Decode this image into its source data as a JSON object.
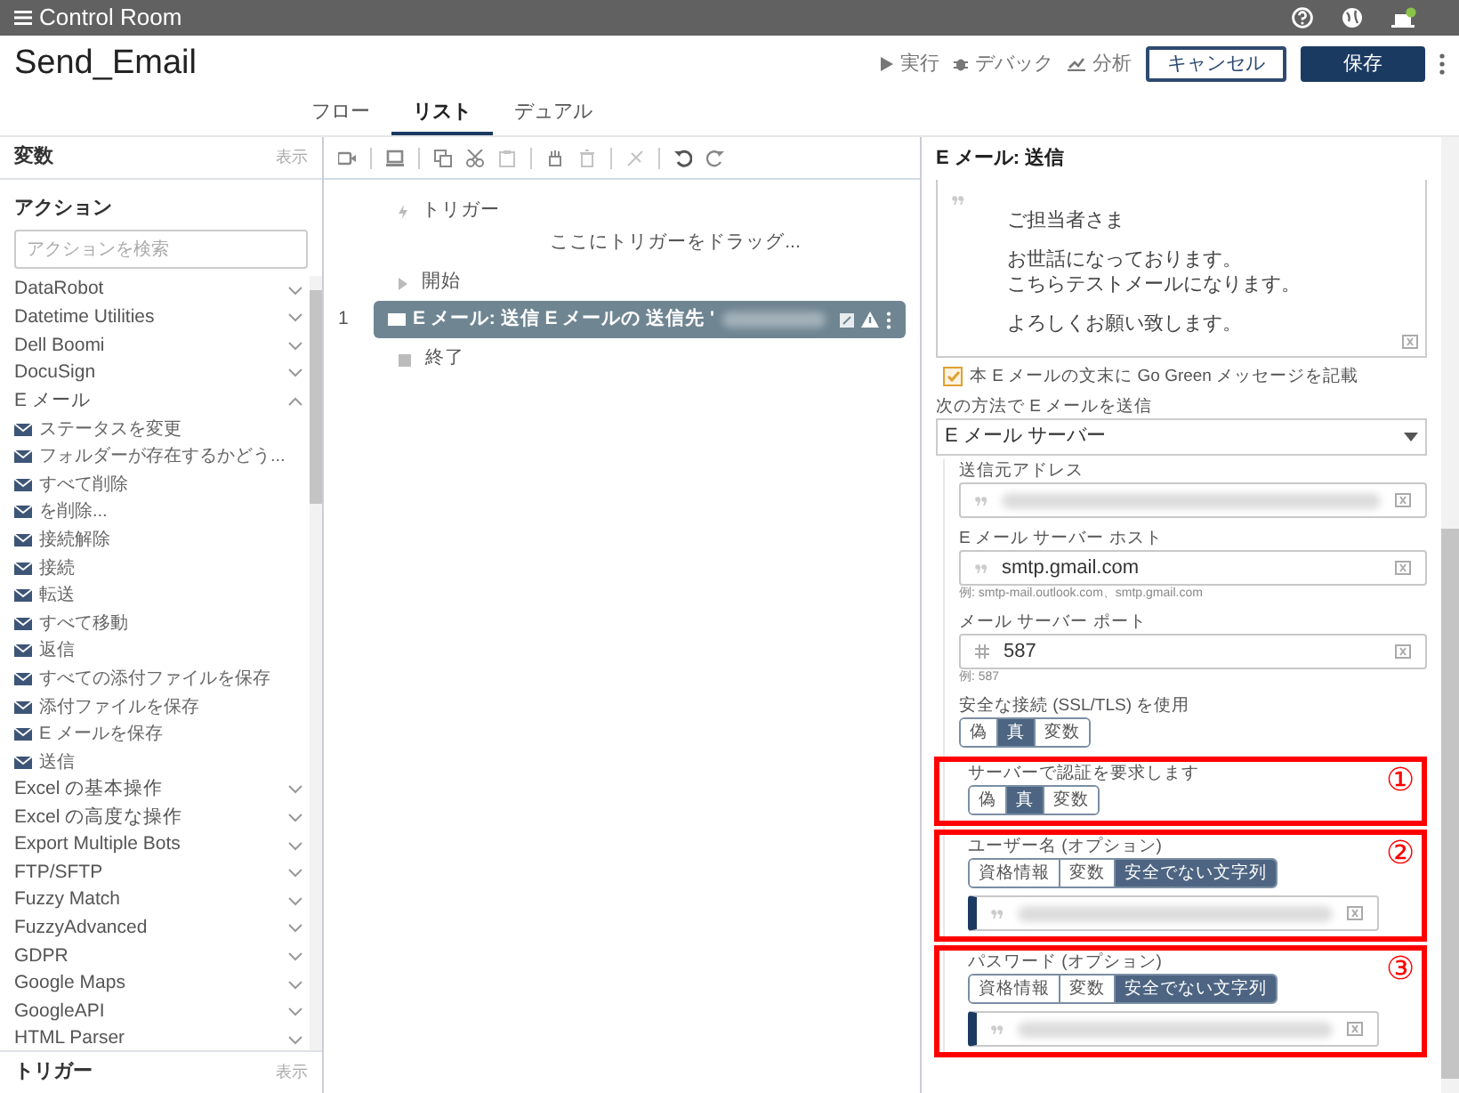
{
  "header": {
    "app_title": "Control Room"
  },
  "bot": {
    "name": "Send_Email",
    "actions": [
      {
        "kind": "run",
        "label": "実行"
      },
      {
        "kind": "debug",
        "label": "デバック"
      },
      {
        "kind": "analyze",
        "label": "分析"
      }
    ],
    "buttons": [
      {
        "label": "キャンセル",
        "kind": "outline"
      },
      {
        "label": "保存",
        "kind": "primary"
      }
    ]
  },
  "view_tabs": [
    {
      "label": "フロー",
      "selected": false
    },
    {
      "label": "リスト",
      "selected": true
    },
    {
      "label": "デュアル",
      "selected": false
    }
  ],
  "sidebar": {
    "variables": {
      "title": "変数",
      "toggle": "表示"
    },
    "actions": {
      "title": "アクション",
      "search_placeholder": "アクションを検索",
      "packages": [
        {
          "label": "DataRobot",
          "expanded": false
        },
        {
          "label": "Datetime Utilities",
          "expanded": false
        },
        {
          "label": "Dell Boomi",
          "expanded": false
        },
        {
          "label": "DocuSign",
          "expanded": false
        },
        {
          "label": "E メール",
          "expanded": true,
          "children": [
            "ステータスを変更",
            "フォルダーが存在するかどう...",
            "すべて削除",
            "を削除...",
            "接続解除",
            "接続",
            "転送",
            "すべて移動",
            "返信",
            "すべての添付ファイルを保存",
            "添付ファイルを保存",
            "E メールを保存",
            "送信"
          ]
        },
        {
          "label": "Excel の基本操作",
          "expanded": false
        },
        {
          "label": "Excel の高度な操作",
          "expanded": false
        },
        {
          "label": "Export Multiple Bots",
          "expanded": false
        },
        {
          "label": "FTP/SFTP",
          "expanded": false
        },
        {
          "label": "Fuzzy Match",
          "expanded": false
        },
        {
          "label": "FuzzyAdvanced",
          "expanded": false
        },
        {
          "label": "GDPR",
          "expanded": false
        },
        {
          "label": "Google Maps",
          "expanded": false
        },
        {
          "label": "GoogleAPI",
          "expanded": false
        },
        {
          "label": "HTML Parser",
          "expanded": false
        }
      ]
    },
    "triggers": {
      "title": "トリガー",
      "toggle": "表示"
    }
  },
  "editor": {
    "trigger_label": "トリガー",
    "trigger_hint": "ここにトリガーをドラッグ...",
    "start_label": "開始",
    "steps": [
      {
        "number": "1",
        "text": "E メール: 送信 E メールの 送信先 '",
        "selected": true,
        "redacted": true
      }
    ],
    "end_label": "終了"
  },
  "properties": {
    "title": "E メール: 送信",
    "body_paragraphs": [
      [
        "ご担当者さま"
      ],
      [
        "お世話になっております。",
        "こちらテストメールになります。"
      ],
      [
        "よろしくお願い致します。"
      ]
    ],
    "go_green": {
      "label": "本 E メールの文末に Go Green メッセージを記載",
      "checked": true
    },
    "send_method": {
      "label": "次の方法で E メールを送信",
      "value": "E メール サーバー"
    },
    "fields": [
      {
        "kind": "text",
        "label": "送信元アドレス",
        "redacted": true
      },
      {
        "kind": "text",
        "label": "E メール サーバー ホスト",
        "value": "smtp.gmail.com",
        "hint": "例: smtp-mail.outlook.com、smtp.gmail.com"
      },
      {
        "kind": "number",
        "label": "メール サーバー ポート",
        "value": "587",
        "hint": "例: 587"
      },
      {
        "kind": "toggle",
        "label": "安全な接続 (SSL/TLS) を使用",
        "options": [
          {
            "label": "偽",
            "selected": false
          },
          {
            "label": "真",
            "selected": true
          },
          {
            "label": "変数",
            "selected": false
          }
        ]
      },
      {
        "kind": "toggle",
        "label": "サーバーで認証を要求します",
        "annotation": "①",
        "options": [
          {
            "label": "偽",
            "selected": false
          },
          {
            "label": "真",
            "selected": true
          },
          {
            "label": "変数",
            "selected": false
          }
        ]
      },
      {
        "kind": "credential",
        "label": "ユーザー名 (オプション)",
        "annotation": "②",
        "redacted": true,
        "options": [
          {
            "label": "資格情報",
            "selected": false
          },
          {
            "label": "変数",
            "selected": false
          },
          {
            "label": "安全でない文字列",
            "selected": true
          }
        ]
      },
      {
        "kind": "credential",
        "label": "パスワード (オプション)",
        "annotation": "③",
        "redacted": true,
        "options": [
          {
            "label": "資格情報",
            "selected": false
          },
          {
            "label": "変数",
            "selected": false
          },
          {
            "label": "安全でない文字列",
            "selected": true
          }
        ]
      }
    ]
  }
}
